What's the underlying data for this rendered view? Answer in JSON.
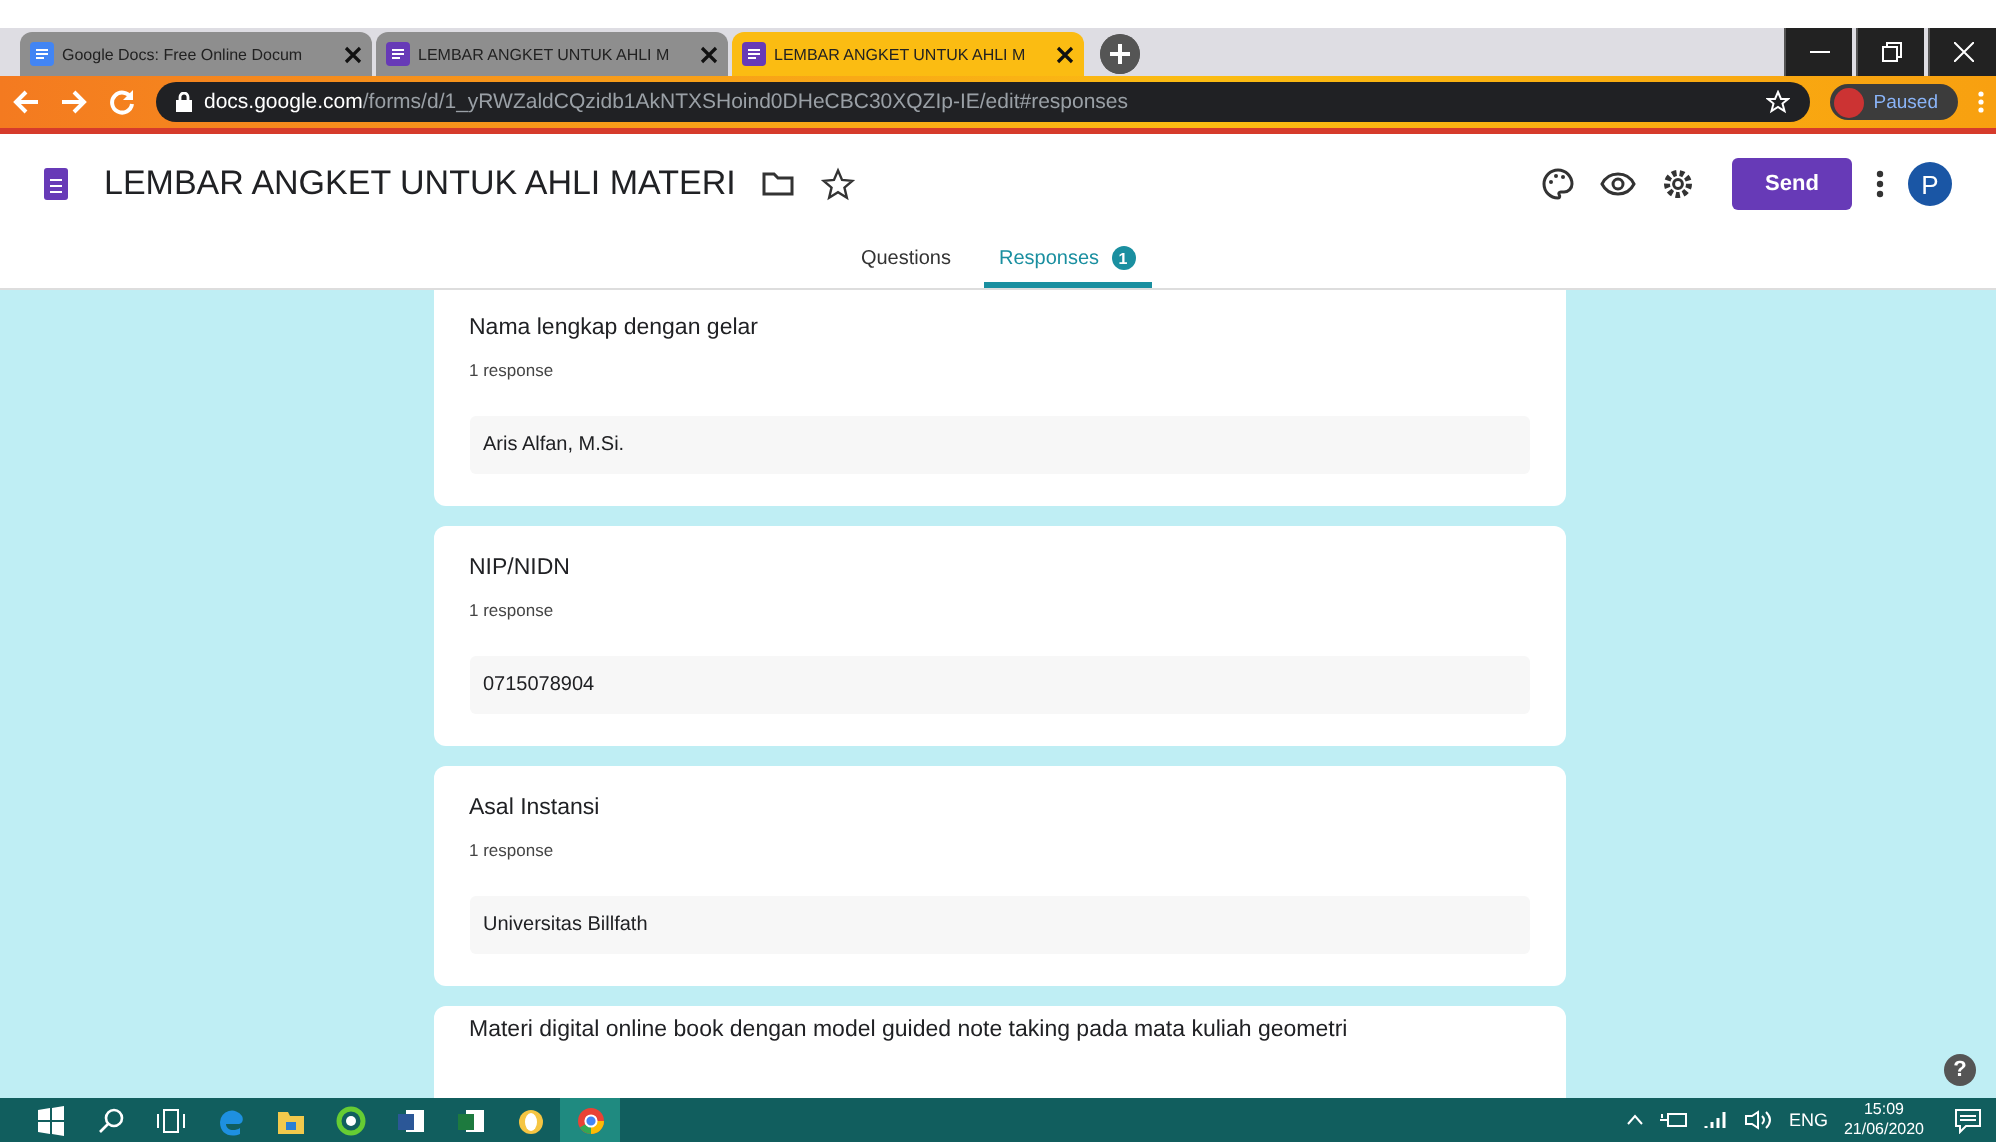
{
  "browser": {
    "tabs": [
      {
        "title": "Google Docs: Free Online Docum",
        "kind": "docs",
        "selected": false
      },
      {
        "title": "LEMBAR ANGKET UNTUK AHLI M",
        "kind": "forms",
        "selected": false
      },
      {
        "title": "LEMBAR ANGKET UNTUK AHLI M",
        "kind": "forms",
        "selected": true
      }
    ],
    "url_host": "docs.google.com",
    "url_path": "/forms/d/1_yRWZaldCQzidb1AkNTXSHoind0DHeCBC30XQZIp-IE/edit#responses",
    "profile_status": "Paused"
  },
  "form": {
    "title": "LEMBAR ANGKET UNTUK AHLI MATERI",
    "send": "Send",
    "account_letter": "P",
    "tabs": [
      {
        "label": "Questions",
        "selected": false
      },
      {
        "label": "Responses",
        "selected": true,
        "badge": "1"
      }
    ]
  },
  "responses": [
    {
      "question": "Nama lengkap dengan gelar",
      "count": "1 response",
      "answers": [
        "Aris Alfan, M.Si."
      ]
    },
    {
      "question": "NIP/NIDN",
      "count": "1 response",
      "answers": [
        "0715078904"
      ]
    },
    {
      "question": "Asal Instansi",
      "count": "1 response",
      "answers": [
        "Universitas Billfath"
      ]
    },
    {
      "question": "Materi digital online book dengan model guided note taking pada mata kuliah geometri"
    }
  ],
  "help": "?",
  "taskbar": {
    "language": "ENG",
    "time": "15:09",
    "date": "21/06/2020"
  }
}
